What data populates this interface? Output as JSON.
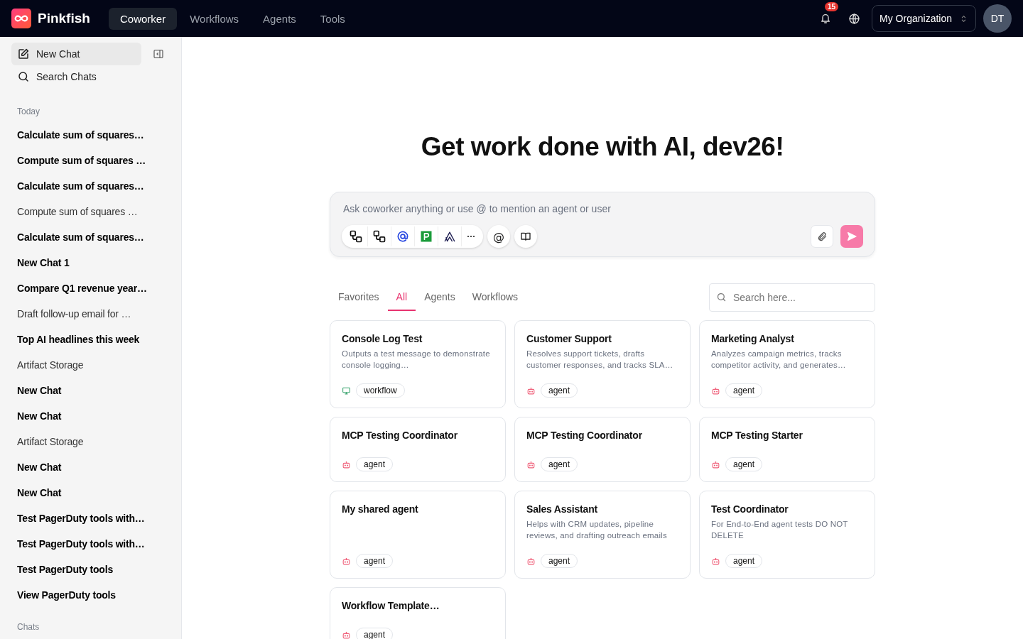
{
  "brand": {
    "name": "Pinkfish"
  },
  "nav": [
    {
      "label": "Coworker",
      "selected": true
    },
    {
      "label": "Workflows",
      "selected": false
    },
    {
      "label": "Agents",
      "selected": false
    },
    {
      "label": "Tools",
      "selected": false
    }
  ],
  "notifications": {
    "count": "15"
  },
  "org_selector": {
    "label": "My Organization"
  },
  "avatar": {
    "initials": "DT"
  },
  "sidebar": {
    "actions": [
      {
        "kind": "new",
        "label": "New Chat",
        "selected": true
      },
      {
        "kind": "search",
        "label": "Search Chats",
        "selected": false
      }
    ],
    "sections": [
      {
        "title": "Today",
        "items": [
          {
            "label": "Calculate sum of squares…",
            "unread": true
          },
          {
            "label": "Compute sum of squares …",
            "unread": true
          },
          {
            "label": "Calculate sum of squares…",
            "unread": true
          },
          {
            "label": "Compute sum of squares …",
            "unread": false
          },
          {
            "label": "Calculate sum of squares…",
            "unread": true
          },
          {
            "label": "New Chat 1",
            "unread": true
          },
          {
            "label": "Compare Q1 revenue year…",
            "unread": true
          },
          {
            "label": "Draft follow-up email for …",
            "unread": false
          },
          {
            "label": "Top AI headlines this week",
            "unread": true
          },
          {
            "label": "Artifact Storage",
            "unread": false
          },
          {
            "label": "New Chat",
            "unread": true
          },
          {
            "label": "New Chat",
            "unread": true
          },
          {
            "label": "Artifact Storage",
            "unread": false
          },
          {
            "label": "New Chat",
            "unread": true
          },
          {
            "label": "New Chat",
            "unread": true
          },
          {
            "label": "Test PagerDuty tools with…",
            "unread": true
          },
          {
            "label": "Test PagerDuty tools with…",
            "unread": true
          },
          {
            "label": "Test PagerDuty tools",
            "unread": true
          },
          {
            "label": "View PagerDuty tools",
            "unread": true
          }
        ]
      },
      {
        "title": "Chats"
      }
    ]
  },
  "heading": "Get work done with AI, dev26!",
  "composer": {
    "placeholder": "Ask coworker anything or use @ to mention an agent or user",
    "tools": [
      {
        "kind": "nodes"
      },
      {
        "kind": "nodes"
      },
      {
        "kind": "ring"
      },
      {
        "kind": "p"
      },
      {
        "kind": "arches"
      },
      {
        "kind": "more"
      }
    ],
    "mention": "@"
  },
  "filter_tabs": [
    {
      "label": "Favorites",
      "selected": false
    },
    {
      "label": "All",
      "selected": true
    },
    {
      "label": "Agents",
      "selected": false
    },
    {
      "label": "Workflows",
      "selected": false
    }
  ],
  "search": {
    "placeholder": "Search here..."
  },
  "cards": [
    {
      "title": "Console Log Test",
      "description": "Outputs a test message to demonstrate console logging…",
      "kind": "workflow",
      "tag": "workflow"
    },
    {
      "title": "Customer Support",
      "description": "Resolves support tickets, drafts customer responses, and tracks SLA…",
      "kind": "agent",
      "tag": "agent"
    },
    {
      "title": "Marketing Analyst",
      "description": "Analyzes campaign metrics, tracks competitor activity, and generates…",
      "kind": "agent",
      "tag": "agent"
    },
    {
      "title": "MCP Testing Coordinator",
      "kind": "agent",
      "tag": "agent"
    },
    {
      "title": "MCP Testing Coordinator",
      "kind": "agent",
      "tag": "agent"
    },
    {
      "title": "MCP Testing Starter",
      "kind": "agent",
      "tag": "agent"
    },
    {
      "title": "My shared agent",
      "kind": "agent",
      "tag": "agent",
      "tall": true
    },
    {
      "title": "Sales Assistant",
      "description": "Helps with CRM updates, pipeline reviews, and drafting outreach emails",
      "kind": "agent",
      "tag": "agent"
    },
    {
      "title": "Test Coordinator",
      "description": "For End-to-End agent tests DO NOT DELETE",
      "kind": "agent",
      "tag": "agent"
    },
    {
      "title": "Workflow Template…",
      "kind": "agent",
      "tag": "agent"
    }
  ]
}
